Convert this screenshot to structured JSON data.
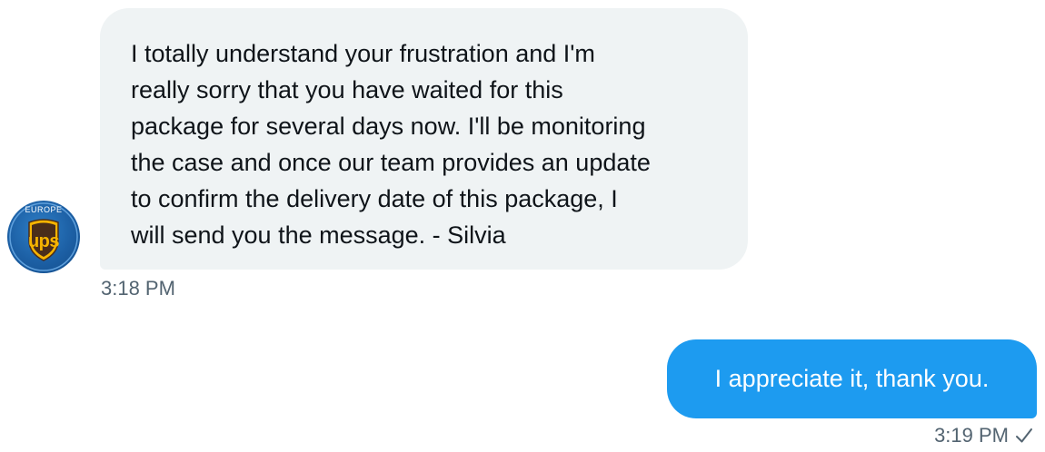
{
  "conversation": {
    "incoming": {
      "avatar": {
        "icon": "ups-europe-logo-icon",
        "ring_text": "EUROPE",
        "logo_text": "ups"
      },
      "text": "I totally understand your frustration and I'm\nreally sorry that you have waited for this\npackage for several days now. I'll be monitoring\nthe case and once our team provides an update\nto confirm the delivery date of this package, I\nwill send you the message. - Silvia",
      "time": "3:18 PM"
    },
    "outgoing": {
      "text": "I appreciate it, thank you.",
      "time": "3:19 PM",
      "status_icon": "checkmark-icon"
    }
  },
  "colors": {
    "incoming_bubble": "#eff3f4",
    "outgoing_bubble": "#1d9bf0",
    "primary_text": "#0f1419",
    "secondary_text": "#536471"
  }
}
